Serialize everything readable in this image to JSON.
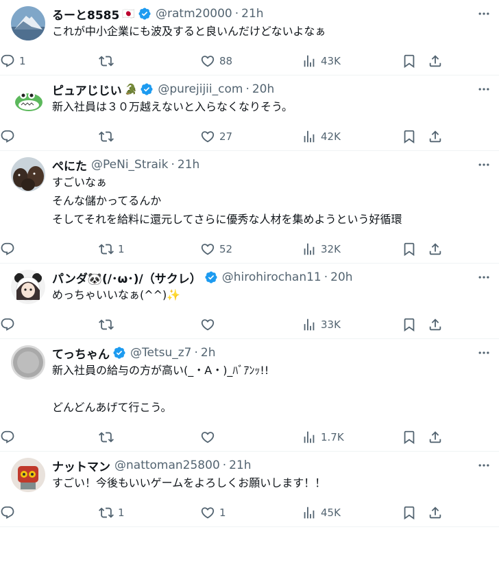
{
  "tweets": [
    {
      "name": "るーと8585",
      "emoji": "🇯🇵",
      "verified": true,
      "handle": "@ratm20000",
      "time": "21h",
      "text": "これが中小企業にも波及すると良いんだけどないよなぁ",
      "replies": "1",
      "retweets": "",
      "likes": "88",
      "views": "43K",
      "avatar": "mountain"
    },
    {
      "name": "ピュアじじい",
      "emoji": "🐊",
      "verified": true,
      "handle": "@purejijii_com",
      "time": "20h",
      "text": "新入社員は３０万越えないと入らなくなりそう。",
      "replies": "",
      "retweets": "",
      "likes": "27",
      "views": "42K",
      "avatar": "dino"
    },
    {
      "name": "ぺにた",
      "emoji": "",
      "verified": false,
      "handle": "@PeNi_Straik",
      "time": "21h",
      "text": "すごいなぁ\nそんな儲かってるんか\nそしてそれを給料に還元してさらに優秀な人材を集めようという好循環",
      "replies": "",
      "retweets": "1",
      "likes": "52",
      "views": "32K",
      "avatar": "dogs"
    },
    {
      "name": "パンダ🐼(/･ω･)/（サクレ）",
      "emoji": "",
      "verified": true,
      "handle": "@hirohirochan11",
      "time": "20h",
      "text": "めっちゃいいなぁ(^^)✨",
      "replies": "",
      "retweets": "",
      "likes": "",
      "views": "33K",
      "avatar": "panda"
    },
    {
      "name": "てっちゃん",
      "emoji": "",
      "verified": true,
      "handle": "@Tetsu_z7",
      "time": "2h",
      "text": "新入社員の給与の方が高い(_・A・)_ﾊﾞｱﾝｯ!!\n\nどんどんあげて行こう。",
      "replies": "",
      "retweets": "",
      "likes": "",
      "views": "1.7K",
      "avatar": "gray"
    },
    {
      "name": "ナットマン",
      "emoji": "",
      "verified": false,
      "handle": "@nattoman25800",
      "time": "21h",
      "text": "すごい！今後もいいゲームをよろしくお願いします！！",
      "replies": "",
      "retweets": "1",
      "likes": "1",
      "views": "45K",
      "avatar": "robot"
    }
  ],
  "colors": {
    "text": "#0f1419",
    "secondary": "#536471",
    "verified": "#1d9bf0",
    "divider": "#eff3f4"
  }
}
